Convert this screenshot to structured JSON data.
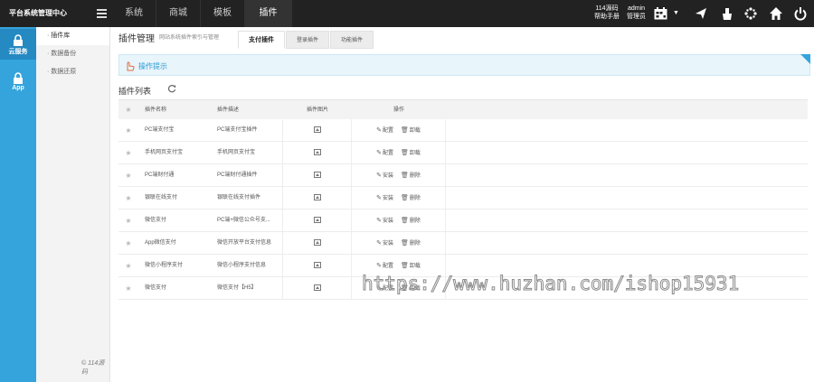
{
  "app": {
    "brand": "平台系统管理中心"
  },
  "topnav": {
    "tabs": [
      {
        "label": "系统",
        "active": false
      },
      {
        "label": "商城",
        "active": false
      },
      {
        "label": "模板",
        "active": false
      },
      {
        "label": "插件",
        "active": true
      }
    ],
    "help_top": "114源码",
    "help_bottom": "帮助手册",
    "user_name": "admin",
    "user_role": "管理员",
    "tools": [
      "calendar-icon",
      "send-icon",
      "clean-icon",
      "flower-icon",
      "home-icon",
      "power-icon"
    ]
  },
  "sidebar": {
    "items": [
      {
        "label": "云服务",
        "icon": "lock-icon",
        "active": true
      },
      {
        "label": "App",
        "icon": "lock-icon",
        "active": false
      }
    ]
  },
  "subnav": {
    "items": [
      {
        "label": "· 插件库",
        "active": true
      },
      {
        "label": "· 数据备份",
        "active": false
      },
      {
        "label": "· 数据还原",
        "active": false
      }
    ],
    "copyright": "© 114源码"
  },
  "page": {
    "title": "插件管理",
    "description": "网站系统插件索引与管理",
    "tabs": [
      {
        "label": "支付插件",
        "active": true
      },
      {
        "label": "登录插件",
        "active": false
      },
      {
        "label": "功能插件",
        "active": false
      }
    ],
    "tip": "操作提示",
    "list_title": "插件列表"
  },
  "table": {
    "headers": [
      "插件名称",
      "插件描述",
      "插件图片",
      "操作"
    ],
    "rows": [
      {
        "name": "PC端支付宝",
        "desc": "PC端支付宝插件",
        "actions": [
          "配置",
          "卸载"
        ]
      },
      {
        "name": "手机网页支付宝",
        "desc": "手机网页支付宝",
        "actions": [
          "配置",
          "卸载"
        ]
      },
      {
        "name": "PC端财付通",
        "desc": "PC端财付通插件",
        "actions": [
          "安装",
          "删除"
        ]
      },
      {
        "name": "银联在线支付",
        "desc": "银联在线支付插件",
        "actions": [
          "安装",
          "删除"
        ]
      },
      {
        "name": "微信支付",
        "desc": "PC端+微信公众号支...",
        "actions": [
          "安装",
          "删除"
        ]
      },
      {
        "name": "App微信支付",
        "desc": "微信开放平台支付信息",
        "actions": [
          "安装",
          "删除"
        ]
      },
      {
        "name": "微信小程序支付",
        "desc": "微信小程序支付信息",
        "actions": [
          "配置",
          "卸载"
        ]
      },
      {
        "name": "微信支付",
        "desc": "微信支付【H5】",
        "actions": [
          "配置",
          "卸载"
        ]
      }
    ]
  },
  "watermark": "https://www.huzhan.com/ishop15931",
  "colors": {
    "sidebar": "#35a4dc",
    "topbar": "#222222",
    "tip_text": "#2d9ad6"
  }
}
